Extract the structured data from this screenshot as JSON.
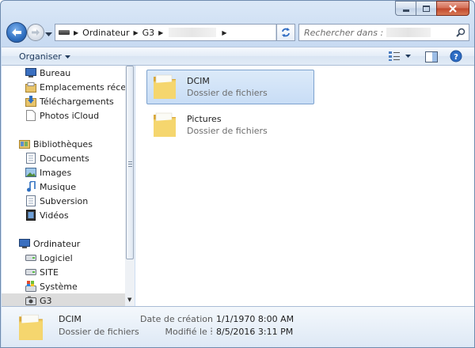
{
  "window": {
    "caption_buttons": [
      "minimize",
      "maximize",
      "close"
    ]
  },
  "address": {
    "crumbs": [
      "Ordinateur",
      "G3"
    ],
    "search_placeholder": "Rechercher dans :"
  },
  "commandbar": {
    "organize_label": "Organiser"
  },
  "navpane": {
    "favorites": [
      {
        "label": "Bureau",
        "icon": "desktop-icon"
      },
      {
        "label": "Emplacements récents",
        "icon": "recent-places-icon"
      },
      {
        "label": "Téléchargements",
        "icon": "downloads-icon"
      },
      {
        "label": "Photos iCloud",
        "icon": "icloud-photos-icon"
      }
    ],
    "libraries_label": "Bibliothèques",
    "libraries": [
      {
        "label": "Documents",
        "icon": "documents-icon"
      },
      {
        "label": "Images",
        "icon": "pictures-icon"
      },
      {
        "label": "Musique",
        "icon": "music-icon"
      },
      {
        "label": "Subversion",
        "icon": "subversion-icon"
      },
      {
        "label": "Vidéos",
        "icon": "videos-icon"
      }
    ],
    "computer_label": "Ordinateur",
    "drives": [
      {
        "label": "Logiciel",
        "icon": "drive-icon"
      },
      {
        "label": "SITE",
        "icon": "drive-icon"
      },
      {
        "label": "Système",
        "icon": "system-drive-icon"
      },
      {
        "label": "G3",
        "icon": "camera-device-icon"
      }
    ]
  },
  "content": {
    "items": [
      {
        "name": "DCIM",
        "type": "Dossier de fichiers",
        "selected": true
      },
      {
        "name": "Pictures",
        "type": "Dossier de fichiers",
        "selected": false
      }
    ]
  },
  "details": {
    "name": "DCIM",
    "type": "Dossier de fichiers",
    "created_label": "Date de création :",
    "created_value": "1/1/1970 8:00 AM",
    "modified_label": "Modifié le :",
    "modified_value": "8/5/2016 3:11 PM"
  },
  "colors": {
    "accent": "#3a78c4",
    "selection": "#cde0f7",
    "folder": "#f0c850"
  }
}
